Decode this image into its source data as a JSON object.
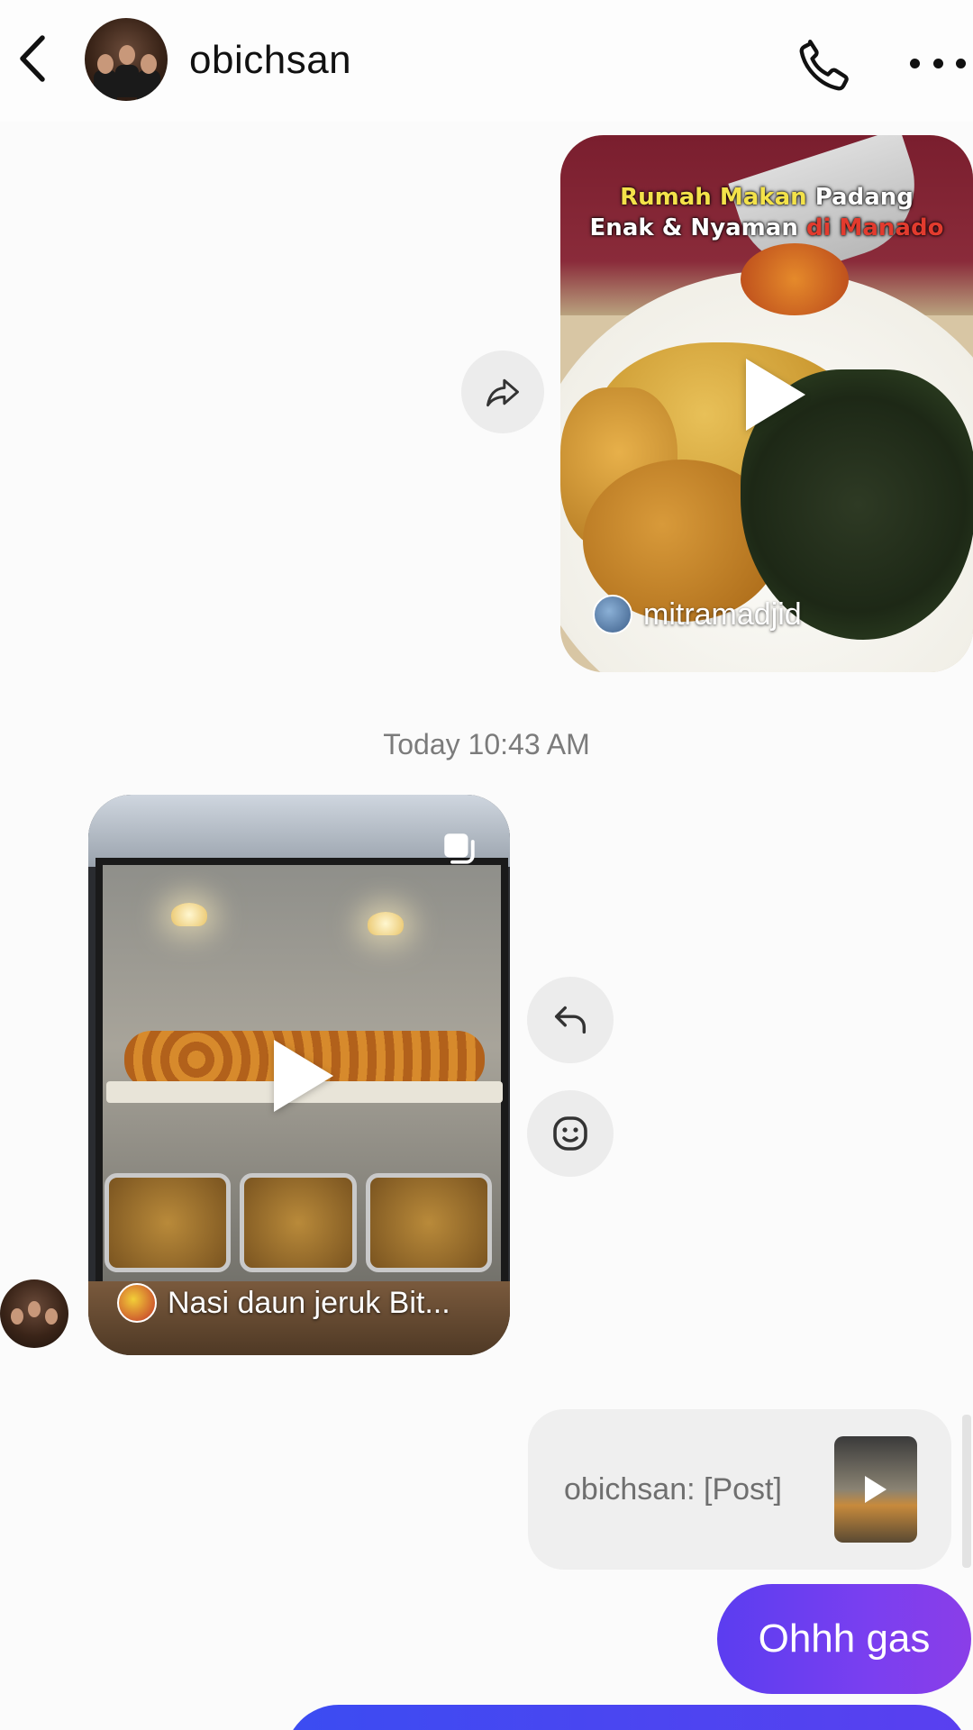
{
  "header": {
    "username": "obichsan",
    "icons": {
      "back": "chevron-left-icon",
      "call": "phone-icon",
      "more": "more-horizontal-icon"
    }
  },
  "messages": {
    "shared_video_1": {
      "caption_line1_part1": "Rumah Makan",
      "caption_line1_part2": "Padang",
      "caption_line2_part1": "Enak & Nyaman",
      "caption_line2_part2": "di Manado",
      "creator": "mitramadjid"
    },
    "timestamp": "Today 10:43 AM",
    "shared_video_2": {
      "creator": "Nasi daun jeruk Bit..."
    },
    "reply_quote": {
      "text": "obichsan: [Post]"
    },
    "sent_text": "Ohhh gas"
  },
  "colors": {
    "sent_bubble_start": "#5b3df0",
    "sent_bubble_end": "#8a3ee8",
    "caption_yellow": "#f3e24a",
    "caption_red": "#e23b2e"
  }
}
